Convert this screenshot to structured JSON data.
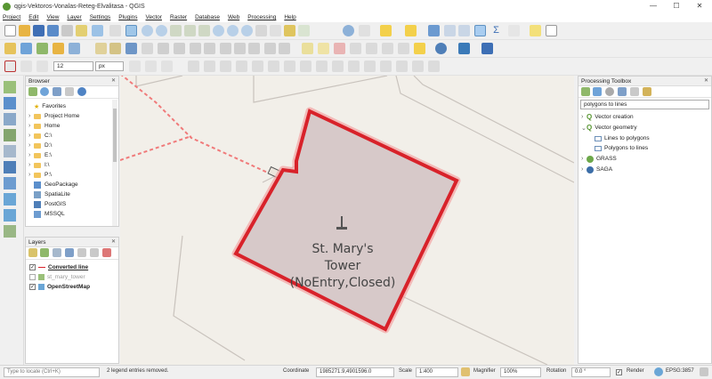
{
  "window": {
    "title": "qgis-Vektoros-Vonalas-Reteg-Elvalitasa - QGIS",
    "minimize": "—",
    "maximize": "☐",
    "close": "✕"
  },
  "menu": [
    "Project",
    "Edit",
    "View",
    "Layer",
    "Settings",
    "Plugins",
    "Vector",
    "Raster",
    "Database",
    "Web",
    "Processing",
    "Help"
  ],
  "snapping": {
    "tolerance": "12",
    "unit": "px"
  },
  "browser": {
    "title": "Browser",
    "items": [
      "Favorites",
      "Project Home",
      "Home",
      "C:\\",
      "D:\\",
      "E:\\",
      "I:\\",
      "P:\\",
      "GeoPackage",
      "SpatiaLite",
      "PostGIS",
      "MSSQL"
    ]
  },
  "layers": {
    "title": "Layers",
    "items": [
      {
        "name": "Converted line",
        "checked": true
      },
      {
        "name": "st_mary_tower",
        "checked": false
      },
      {
        "name": "OpenStreetMap",
        "checked": true
      }
    ]
  },
  "toolbox": {
    "title": "Processing Toolbox",
    "search": "polygons to lines",
    "items": [
      "Vector creation",
      "Vector geometry",
      "Lines to polygons",
      "Polygons to lines",
      "GRASS",
      "SAGA"
    ]
  },
  "map": {
    "label_line1": "St. Mary's",
    "label_line2": "Tower",
    "label_line3": "(NoEntry,Closed)",
    "polygon_stroke": "#d8222a",
    "polygon_fill": "#d7c9c9"
  },
  "status": {
    "locate_placeholder": "Type to locate (Ctrl+K)",
    "message": "2 legend entries removed.",
    "coordinate_label": "Coordinate",
    "coordinate_value": "1985271.9,4901596.0",
    "scale_label": "Scale",
    "scale_value": "1:400",
    "magnifier_label": "Magnifier",
    "magnifier_value": "100%",
    "rotation_label": "Rotation",
    "rotation_value": "0.0 °",
    "render_label": "Render",
    "crs": "EPSG:3857"
  }
}
